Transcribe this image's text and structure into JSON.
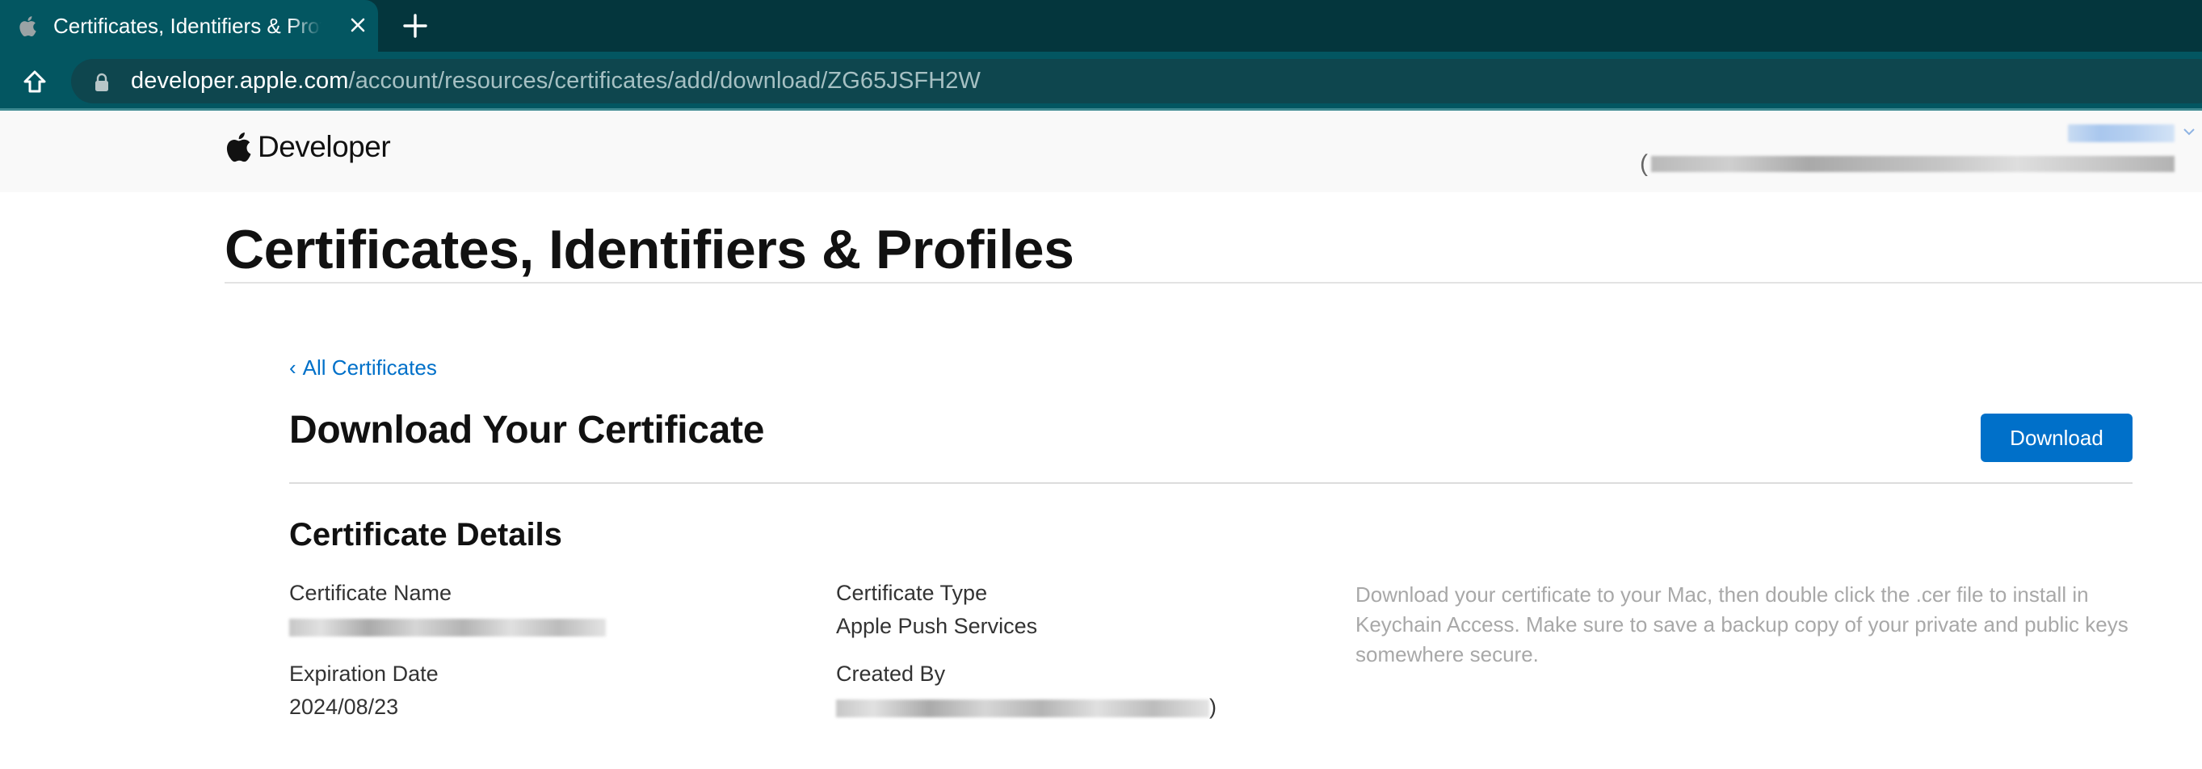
{
  "browser": {
    "tab": {
      "title": "Certificates, Identifiers & Profiles - Apple Developer",
      "favicon": "apple-icon",
      "close_icon": "close-icon"
    },
    "new_tab_icon": "plus-icon",
    "home_icon": "home-icon",
    "address_bar": {
      "lock_icon": "lock-icon",
      "host": "developer.apple.com",
      "path": "/account/resources/certificates/add/download/ZG65JSFH2W"
    }
  },
  "header": {
    "brand": "Developer",
    "logo_icon": "apple-icon",
    "account_name": "[redacted]",
    "team_name": "(Enterprise) [redacted]",
    "account_chevron_icon": "chevron-down-icon"
  },
  "page": {
    "title": "Certificates, Identifiers & Profiles",
    "back_link": {
      "chevron": "‹",
      "label": "All Certificates"
    },
    "section_title": "Download Your Certificate",
    "download_button": "Download",
    "details": {
      "title": "Certificate Details",
      "fields": [
        {
          "label": "Certificate Name",
          "value": "[redacted]"
        },
        {
          "label": "Certificate Type",
          "value": "Apple Push Services"
        },
        {
          "label": "Expiration Date",
          "value": "2024/08/23"
        },
        {
          "label": "Created By",
          "value": "[redacted]"
        }
      ],
      "help_text": "Download your certificate to your Mac, then double click the .cer file to install in Keychain Access. Make sure to save a backup copy of your private and public keys somewhere secure."
    }
  },
  "colors": {
    "accent": "#0070c9",
    "chrome_tab": "#035661",
    "chrome_bg": "#04363d",
    "header_bg": "#f9f9f9"
  }
}
